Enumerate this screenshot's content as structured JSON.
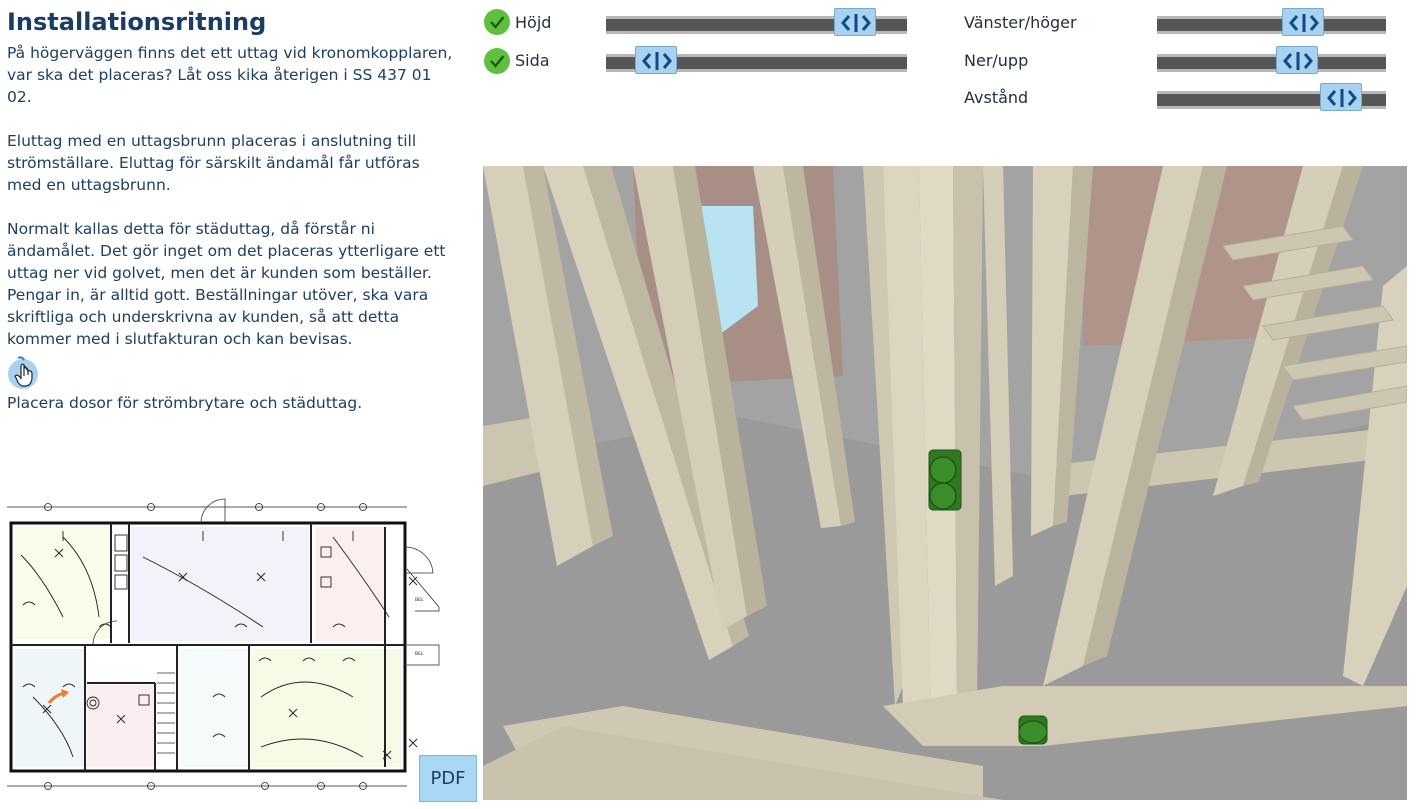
{
  "left_panel": {
    "title": "Installationsritning",
    "para1": "På högerväggen finns det ett uttag vid kronomkopplaren, var ska det placeras? Låt oss kika återigen i SS 437 01 02.",
    "para2": "Eluttag med en uttagsbrunn placeras i anslutning till strömställare. Eluttag för särskilt ändamål får utföras med en uttagsbrunn.",
    "para3": "Normalt kallas detta för städuttag, då förstår ni ändamålet. Det gör inget om det placeras ytterligare ett uttag ner vid golvet, men det är kunden som beställer. Pengar in, är alltid gott. Beställningar utöver, ska vara skriftliga och underskrivna av kunden, så att detta kommer med i slutfakturan och kan bevisas.",
    "instruction": "Placera dosor för strömbrytare och städuttag.",
    "pdf_label": "PDF",
    "hand_icon": "pointer-hand-icon"
  },
  "controls": {
    "left": [
      {
        "label": "Höjd",
        "checked": true,
        "value": 0.82
      },
      {
        "label": "Sida",
        "checked": true,
        "value": 0.15
      }
    ],
    "right": [
      {
        "label": "Vänster/höger",
        "value": 0.63
      },
      {
        "label": "Ner/upp",
        "value": 0.61
      },
      {
        "label": "Avstånd",
        "value": 0.81
      }
    ]
  },
  "colors": {
    "title": "#1a3d63",
    "slider_thumb": "#a8d2ef",
    "check": "#5fbf3f",
    "outlet": "#2f7a20"
  }
}
